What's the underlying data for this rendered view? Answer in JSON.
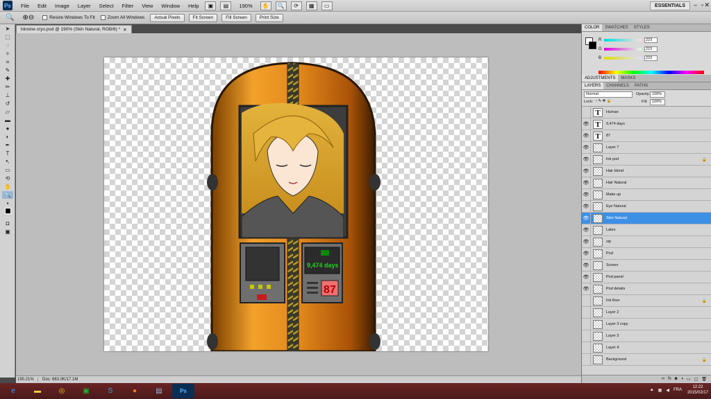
{
  "app": {
    "logo": "Ps",
    "menu": [
      "File",
      "Edit",
      "Image",
      "Layer",
      "Select",
      "Filter",
      "View",
      "Window",
      "Help"
    ],
    "zoom_level": "190%",
    "workspace": "ESSENTIALS",
    "window_controls": [
      "–",
      "▫",
      "✕"
    ]
  },
  "options": {
    "checks": [
      "Resize Windows To Fit",
      "Zoom All Windows"
    ],
    "buttons": [
      "Actual Pixels",
      "Fit Screen",
      "Fill Screen",
      "Print Size"
    ]
  },
  "document": {
    "tab_title": "hiiroine cryo.psd @ 190% (Skin Natural, RGB/8) *",
    "status_zoom": "190.21%",
    "status_doc": "Doc: 663.0K/17.1M",
    "pod_screen_text": "9,474 days",
    "pod_counter": "87"
  },
  "color_panel": {
    "tabs": [
      "COLOR",
      "SWATCHES",
      "STYLES"
    ],
    "r_label": "R",
    "g_label": "G",
    "b_label": "B",
    "r": "223",
    "g": "223",
    "b": "223"
  },
  "adjust_tabs": [
    "ADJUSTMENTS",
    "MASKS"
  ],
  "layers_panel": {
    "tabs": [
      "LAYERS",
      "CHANNELS",
      "PATHS"
    ],
    "blend_mode": "Normal",
    "opacity_label": "Opacity:",
    "opacity": "100%",
    "lock_label": "Lock:",
    "fill_label": "Fill:",
    "fill": "100%",
    "layers": [
      {
        "name": "Human",
        "visible": false,
        "text": true,
        "locked": false
      },
      {
        "name": "9,474 days",
        "visible": true,
        "text": true,
        "locked": false
      },
      {
        "name": "87",
        "visible": true,
        "text": true,
        "locked": false
      },
      {
        "name": "Layer 7",
        "visible": true,
        "text": false,
        "locked": false
      },
      {
        "name": "Ink pod",
        "visible": true,
        "text": false,
        "locked": true
      },
      {
        "name": "Hair blond",
        "visible": true,
        "text": false,
        "locked": false
      },
      {
        "name": "Hair Natural",
        "visible": true,
        "text": false,
        "locked": false
      },
      {
        "name": "Make up",
        "visible": true,
        "text": false,
        "locked": false
      },
      {
        "name": "Eye Natural",
        "visible": true,
        "text": false,
        "locked": false
      },
      {
        "name": "Skin Natural",
        "visible": true,
        "text": false,
        "locked": false,
        "selected": true
      },
      {
        "name": "Latex",
        "visible": true,
        "text": false,
        "locked": false
      },
      {
        "name": "zip",
        "visible": true,
        "text": false,
        "locked": false
      },
      {
        "name": "Pod",
        "visible": true,
        "text": false,
        "locked": false
      },
      {
        "name": "Screen",
        "visible": true,
        "text": false,
        "locked": false
      },
      {
        "name": "Pod panel",
        "visible": true,
        "text": false,
        "locked": false
      },
      {
        "name": "Pod details",
        "visible": true,
        "text": false,
        "locked": false
      },
      {
        "name": "Ink floor",
        "visible": false,
        "text": false,
        "locked": true
      },
      {
        "name": "Layer 2",
        "visible": false,
        "text": false,
        "locked": false
      },
      {
        "name": "Layer 3 copy",
        "visible": false,
        "text": false,
        "locked": false
      },
      {
        "name": "Layer 3",
        "visible": false,
        "text": false,
        "locked": false
      },
      {
        "name": "Layer 4",
        "visible": false,
        "text": false,
        "locked": false
      },
      {
        "name": "Background",
        "visible": false,
        "text": false,
        "locked": true
      }
    ]
  },
  "taskbar": {
    "lang": "FRA",
    "time": "12:22",
    "date": "2015/02/17"
  }
}
